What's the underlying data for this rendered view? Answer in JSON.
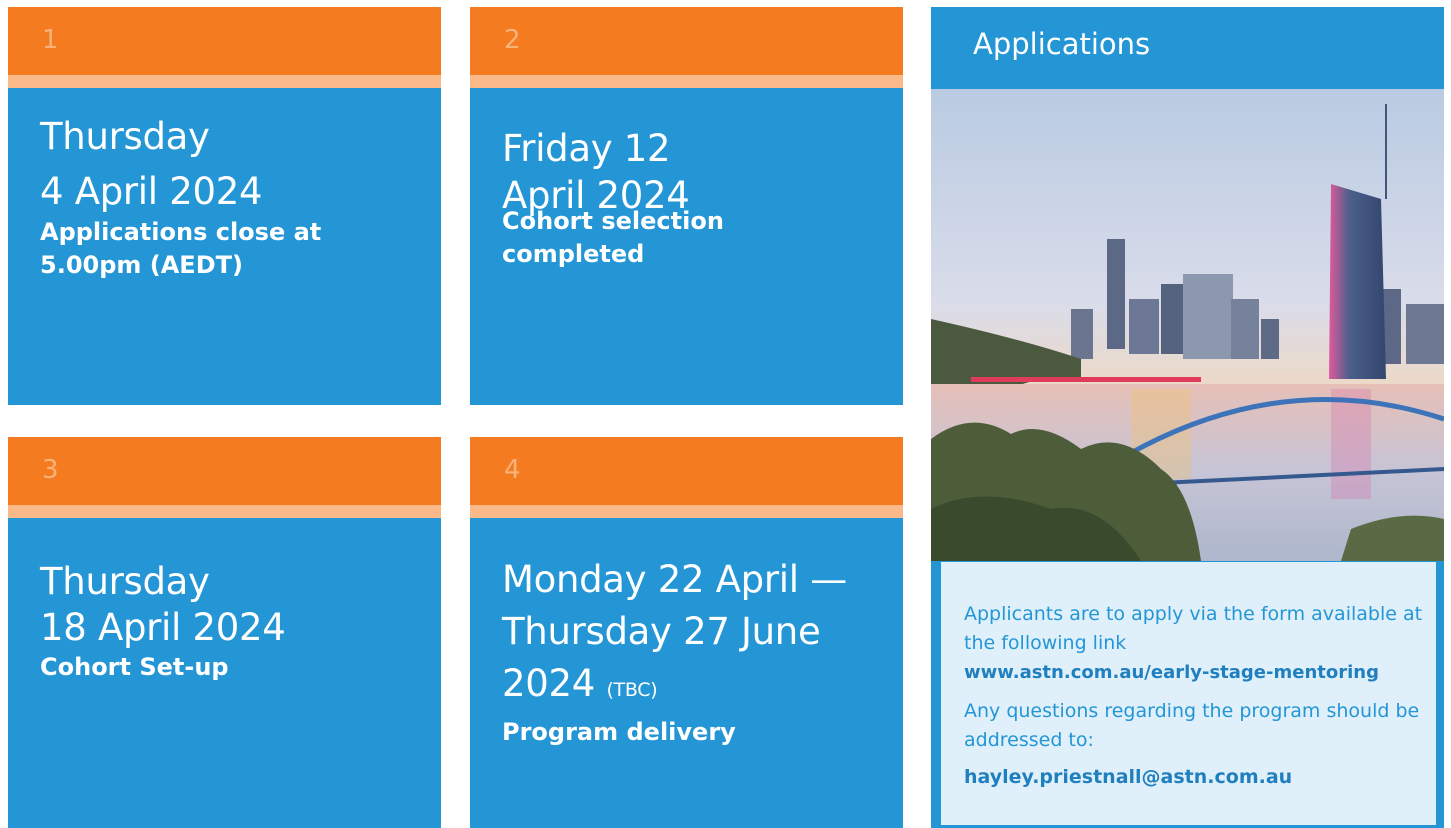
{
  "cards": [
    {
      "number": "1",
      "line1": "Thursday",
      "line2": "4 April 2024",
      "subtitle": "Applications close at 5.00pm (AEDT)"
    },
    {
      "number": "2",
      "line1": "Friday 12",
      "line2": "April 2024",
      "subtitle": "Cohort selection completed"
    },
    {
      "number": "3",
      "line1": "Thursday",
      "line2": "18 April 2024",
      "subtitle": "Cohort Set-up"
    },
    {
      "number": "4",
      "line1": "Monday 22 April —",
      "line2": "Thursday 27 June",
      "line3": "2024",
      "note": "(TBC)",
      "subtitle": "Program delivery"
    }
  ],
  "applications": {
    "title": "Applications",
    "photo_icon": "city-skyline-photo",
    "text1": "Applicants are to apply via the form available at the following link",
    "link": "www.astn.com.au/early-stage-mentoring",
    "text2": "Any questions regarding the program should be addressed to:",
    "email": "hayley.priestnall@astn.com.au"
  },
  "colors": {
    "blue": "#2496d6",
    "orange": "#f47b20",
    "light_orange": "#fbb98a",
    "pale_blue": "#dff0fa"
  }
}
